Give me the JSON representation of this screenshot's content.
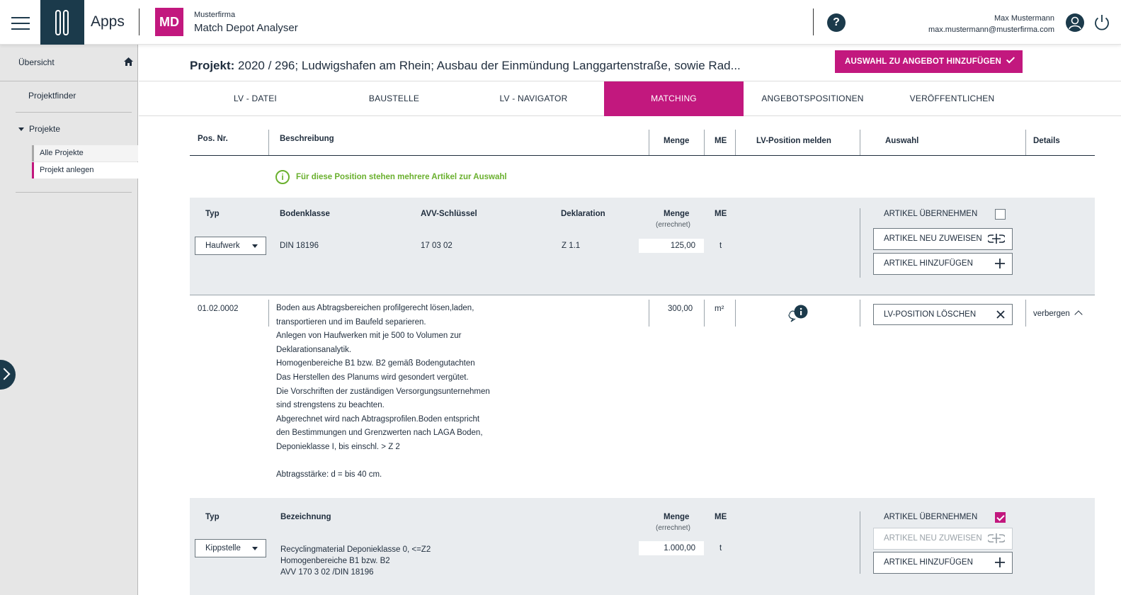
{
  "header": {
    "apps_label": "Apps",
    "badge": "MD",
    "company": "Musterfirma",
    "app_name": "Match Depot Analyser",
    "help": "?",
    "user_name": "Max Mustermann",
    "user_email": "max.mustermann@musterfirma.com"
  },
  "sidebar": {
    "overview": "Übersicht",
    "projektfinder": "Projektfinder",
    "projekte": "Projekte",
    "sub": [
      "Alle Projekte",
      "Projekt anlegen"
    ]
  },
  "project": {
    "label": "Projekt:",
    "title": "2020 / 296; Ludwigshafen am Rhein; Ausbau der Einmündung Langgartenstraße, sowie Rad...",
    "add_button": "AUSWAHL ZU ANGEBOT HINZUFÜGEN"
  },
  "tabs": [
    "LV - DATEI",
    "BAUSTELLE",
    "LV - NAVIGATOR",
    "MATCHING",
    "ANGEBOTSPOSITIONEN",
    "VERÖFFENTLICHEN"
  ],
  "active_tab": "MATCHING",
  "table": {
    "headers": {
      "pos": "Pos. Nr.",
      "desc": "Beschreibung",
      "menge": "Menge",
      "me": "ME",
      "melden": "LV-Position melden",
      "auswahl": "Auswahl",
      "details": "Details"
    },
    "info": "Für diese Position stehen mehrere Artikel zur Auswahl"
  },
  "panel1": {
    "h_typ": "Typ",
    "h_bodenklasse": "Bodenklasse",
    "h_avv": "AVV-Schlüssel",
    "h_deklaration": "Deklaration",
    "h_menge": "Menge",
    "h_menge_sub": "(errechnet)",
    "h_me": "ME",
    "typ": "Haufwerk",
    "bodenklasse": "DIN 18196",
    "avv": "17 03 02",
    "deklaration": "Z 1.1",
    "menge": "125,00",
    "me": "t",
    "uebernehmen": "ARTIKEL ÜBERNEHMEN",
    "neu_zuweisen": "ARTIKEL NEU ZUWEISEN",
    "hinzufuegen": "ARTIKEL HINZUFÜGEN"
  },
  "position": {
    "pos": "01.02.0002",
    "lines": [
      "Boden aus Abtragsbereichen profilgerecht lösen,laden,",
      "transportieren und im Baufeld separieren.",
      "Anlegen von Haufwerken mit je 500 to Volumen zur",
      "Deklarationsanalytik.",
      "Homogenbereiche B1 bzw. B2 gemäß Bodengutachten",
      "Das Herstellen des Planums wird gesondert vergütet.",
      "Die Vorschriften der zuständigen Versorgungsunternehmen",
      "sind strengstens zu beachten.",
      "Abgerechnet wird nach Abtragsprofilen.Boden entspricht",
      "den Bestimmungen und Grenzwerten nach LAGA Boden,",
      "Deponieklasse I, bis einschl. > Z 2",
      "",
      "Abtragsstärke: d = bis 40 cm."
    ],
    "menge": "300,00",
    "me": "m²",
    "delete": "LV-POSITION LÖSCHEN",
    "hide": "verbergen"
  },
  "panel2": {
    "h_typ": "Typ",
    "h_bezeichnung": "Bezeichnung",
    "h_menge": "Menge",
    "h_menge_sub": "(errechnet)",
    "h_me": "ME",
    "typ": "Kippstelle",
    "bezeichnung": [
      "Recyclingmaterial Deponieklasse 0, <=Z2",
      "Homogenbereiche B1 bzw. B2",
      "AVV 170 3 02 /DIN 18196"
    ],
    "menge": "1.000,00",
    "me": "t",
    "uebernehmen": "ARTIKEL ÜBERNEHMEN",
    "neu_zuweisen": "ARTIKEL NEU ZUWEISEN",
    "hinzufuegen": "ARTIKEL HINZUFÜGEN"
  },
  "colors": {
    "accent": "#c2187e",
    "navy": "#1b3a4b",
    "success": "#6ab02e",
    "panel": "#e9ecef"
  }
}
